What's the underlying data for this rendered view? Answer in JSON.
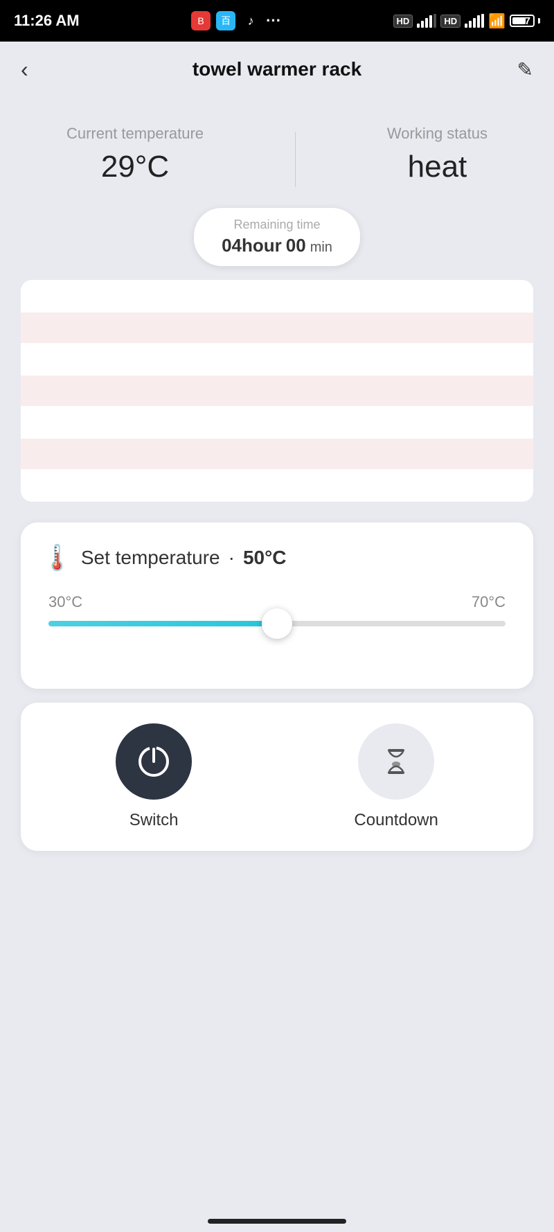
{
  "statusBar": {
    "time": "11:26 AM",
    "battery": "67",
    "batteryLabel": "67"
  },
  "header": {
    "title": "towel warmer rack",
    "backLabel": "‹",
    "editLabel": "✎"
  },
  "statusSection": {
    "tempLabel": "Current temperature",
    "tempValue": "29°C",
    "workingLabel": "Working status",
    "workingValue": "heat"
  },
  "timer": {
    "remainingLabel": "Remaining time",
    "hourValue": "04hour",
    "minValue": "00",
    "minLabel": "min"
  },
  "temperatureCard": {
    "title": "Set temperature",
    "dot": "·",
    "setValue": "50°C",
    "sliderMin": "30°C",
    "sliderMax": "70°C",
    "sliderValue": 50,
    "sliderMinVal": 30,
    "sliderMaxVal": 70
  },
  "controls": {
    "switchLabel": "Switch",
    "countdownLabel": "Countdown"
  }
}
